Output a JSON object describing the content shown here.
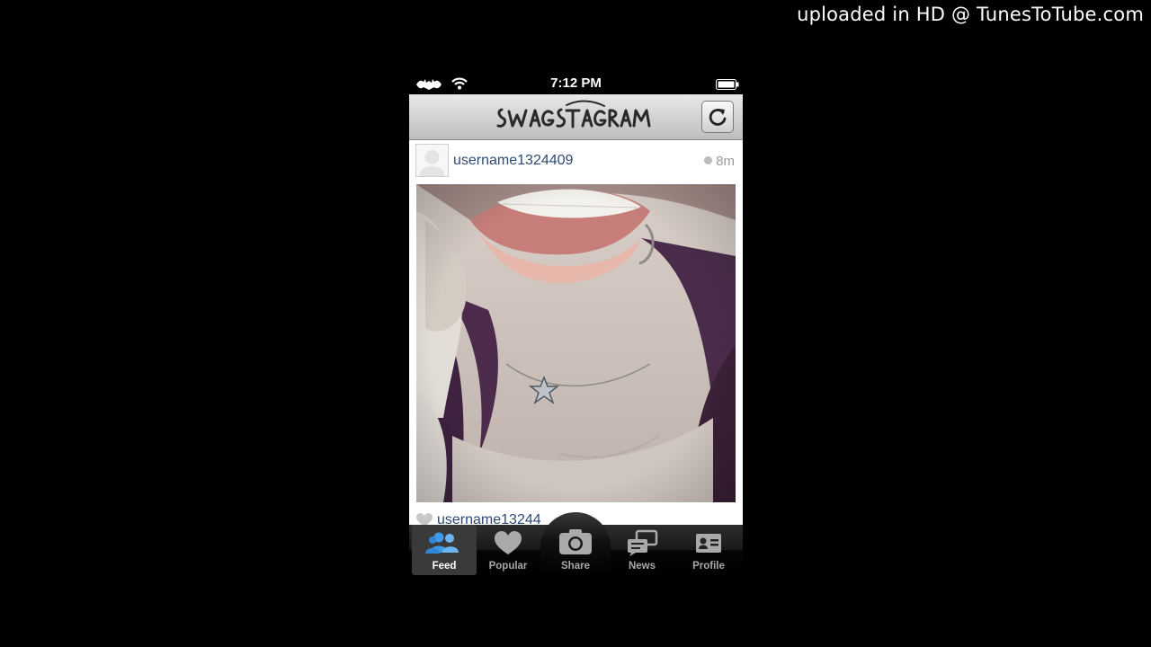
{
  "watermark": "uploaded in HD @ TunesToTube.com",
  "status_bar": {
    "time": "7:12 PM",
    "carrier_icon": "bat-logo-icon",
    "wifi_icon": "wifi-icon",
    "battery_icon": "battery-icon"
  },
  "app": {
    "logo_text": "SWAGSTAGRAM",
    "refresh_icon": "refresh-icon"
  },
  "post": {
    "username": "username1324409",
    "time_ago": "8m",
    "photo": {
      "description": "selfie-close-up-lips-star-necklace"
    },
    "like_username": "username13244"
  },
  "tabs": [
    {
      "id": "feed",
      "label": "Feed",
      "icon": "people-icon",
      "active": true
    },
    {
      "id": "popular",
      "label": "Popular",
      "icon": "heart-icon",
      "active": false
    },
    {
      "id": "share",
      "label": "Share",
      "icon": "camera-icon",
      "active": false
    },
    {
      "id": "news",
      "label": "News",
      "icon": "news-bubbles-icon",
      "active": false
    },
    {
      "id": "profile",
      "label": "Profile",
      "icon": "profile-card-icon",
      "active": false
    }
  ],
  "colors": {
    "accent": "#3e9be9",
    "username": "#2c4a74"
  }
}
